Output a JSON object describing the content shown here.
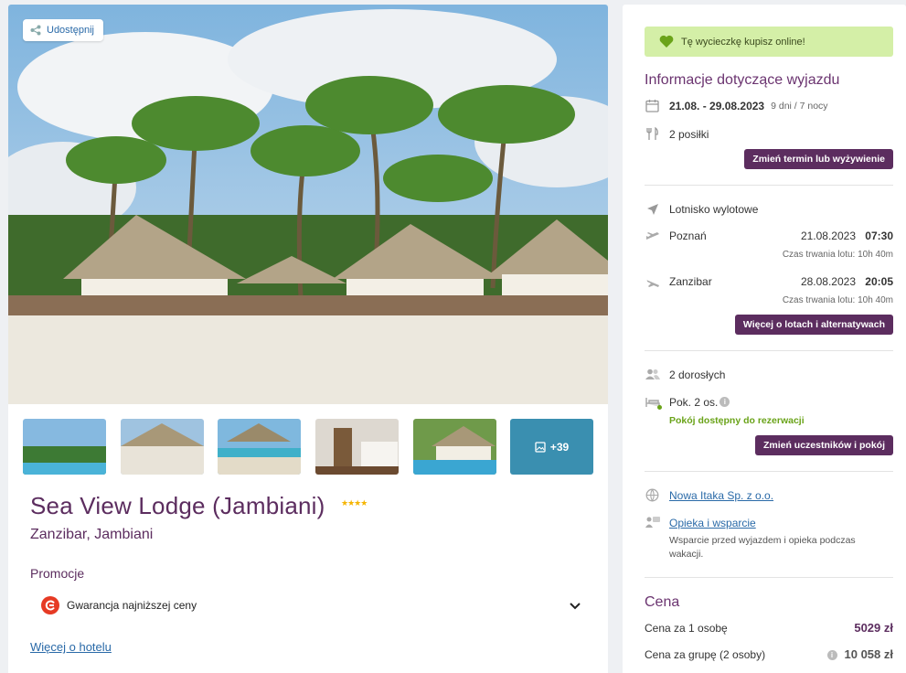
{
  "gallery": {
    "share_label": "Udostępnij",
    "more_photos_label": "+39"
  },
  "hotel": {
    "name": "Sea View Lodge (Jambiani)",
    "stars": "★★★★",
    "location": "Zanzibar, Jambiani",
    "promo_title": "Promocje",
    "promo_label": "Gwarancja najniższej ceny",
    "more_link": "Więcej o hotelu"
  },
  "trip": {
    "online_banner": "Tę wycieczkę kupisz online!",
    "title": "Informacje dotyczące wyjazdu",
    "dates": "21.08. - 29.08.2023",
    "duration": "9 dni / 7 nocy",
    "meals": "2 posiłki",
    "change_date_button": "Zmień termin lub wyżywienie",
    "airport_title": "Lotnisko wylotowe",
    "outbound": {
      "city": "Poznań",
      "date": "21.08.2023",
      "time": "07:30",
      "duration": "Czas trwania lotu: 10h 40m"
    },
    "return": {
      "city": "Zanzibar",
      "date": "28.08.2023",
      "time": "20:05",
      "duration": "Czas trwania lotu: 10h 40m"
    },
    "flights_button": "Więcej o lotach i alternatywach",
    "adults": "2 dorosłych",
    "room": "Pok. 2 os.",
    "room_available": "Pokój dostępny do rezerwacji",
    "change_participants_button": "Zmień uczestników i pokój",
    "operator_link": "Nowa Itaka Sp. z o.o.",
    "support_link": "Opieka i wsparcie",
    "support_note": "Wsparcie przed wyjazdem i opieka podczas wakacji."
  },
  "price": {
    "title": "Cena",
    "per_person_label": "Cena za 1 osobę",
    "per_person_value": "5029 zł",
    "group_label": "Cena za grupę (2 osoby)",
    "group_value": "10 058 zł"
  },
  "colors": {
    "brand_purple": "#5c2d5f",
    "link_blue": "#2a6aa8",
    "banner_green": "#d4efa7",
    "available_green": "#6aa319"
  }
}
